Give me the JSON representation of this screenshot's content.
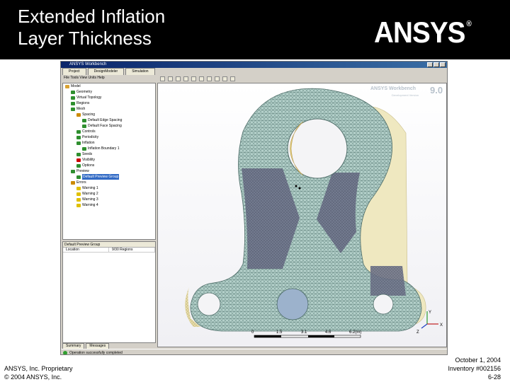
{
  "slide": {
    "title_line1": "Extended Inflation",
    "title_line2": "Layer Thickness",
    "logo_text": "ANSYS",
    "logo_mark": "®",
    "footer_left_line1": "ANSYS, Inc. Proprietary",
    "footer_left_line2": "© 2004 ANSYS, Inc.",
    "footer_right_line1": "October 1, 2004",
    "footer_right_line2": "Inventory #002156",
    "footer_right_line3": "6-28"
  },
  "window": {
    "title": "ANSYS Workbench",
    "tabs": [
      {
        "label": "Project"
      },
      {
        "label": "DesignModeler"
      },
      {
        "label": "Simulation"
      }
    ],
    "menu_label": "File  Tools  View  Units  Help",
    "tree": [
      {
        "label": "Model",
        "indent": 0,
        "icon": "model-icon",
        "color": "#d9a233"
      },
      {
        "label": "Geometry",
        "indent": 1,
        "icon": "geometry-icon",
        "color": "#2f8f2f"
      },
      {
        "label": "Virtual Topology",
        "indent": 1,
        "icon": "topology-icon",
        "color": "#2f8f2f"
      },
      {
        "label": "Regions",
        "indent": 1,
        "icon": "regions-icon",
        "color": "#2f8f2f"
      },
      {
        "label": "Mesh",
        "indent": 1,
        "icon": "mesh-icon",
        "color": "#2f8f2f"
      },
      {
        "label": "Spacing",
        "indent": 2,
        "icon": "spacing-icon",
        "color": "#cc8a00"
      },
      {
        "label": "Default Edge Spacing",
        "indent": 3,
        "icon": "edge-icon",
        "color": "#2f8f2f"
      },
      {
        "label": "Default Face Spacing",
        "indent": 3,
        "icon": "face-icon",
        "color": "#2f8f2f"
      },
      {
        "label": "Controls",
        "indent": 2,
        "icon": "controls-icon",
        "color": "#2f8f2f"
      },
      {
        "label": "Periodicity",
        "indent": 2,
        "icon": "periodicity-icon",
        "color": "#2f8f2f"
      },
      {
        "label": "Inflation",
        "indent": 2,
        "icon": "inflation-icon",
        "color": "#2f8f2f"
      },
      {
        "label": "Inflation Boundary 1",
        "indent": 3,
        "icon": "boundary-icon",
        "color": "#2f8f2f"
      },
      {
        "label": "Seeds",
        "indent": 2,
        "icon": "seeds-icon",
        "color": "#2f8f2f"
      },
      {
        "label": "Visibility",
        "indent": 2,
        "icon": "visibility-icon",
        "color": "#cc0000"
      },
      {
        "label": "Options",
        "indent": 2,
        "icon": "options-icon",
        "color": "#2f8f2f"
      },
      {
        "label": "Preview",
        "indent": 1,
        "icon": "preview-icon",
        "color": "#2f8f2f"
      },
      {
        "label": "Default Preview Group",
        "indent": 2,
        "icon": "preview-group-icon",
        "color": "#2f8f2f",
        "selected": true
      },
      {
        "label": "Errors",
        "indent": 1,
        "icon": "errors-icon",
        "color": "#cc8a00"
      },
      {
        "label": "Warning 1",
        "indent": 2,
        "icon": "warning-icon",
        "color": "#e0c000"
      },
      {
        "label": "Warning 2",
        "indent": 2,
        "icon": "warning-icon",
        "color": "#e0c000"
      },
      {
        "label": "Warning 3",
        "indent": 2,
        "icon": "warning-icon",
        "color": "#e0c000"
      },
      {
        "label": "Warning 4",
        "indent": 2,
        "icon": "warning-icon",
        "color": "#e0c000"
      }
    ],
    "details": {
      "header": "Default Preview Group",
      "rows": [
        {
          "key": "Location",
          "value": "9/30 Regions"
        }
      ]
    },
    "bottom_tabs": [
      {
        "label": "Summary"
      },
      {
        "label": "Messages"
      }
    ],
    "status": "Operation successfully completed",
    "viewport": {
      "brand": "ANSYS Workbench",
      "version": "9.0",
      "brand_sub": "Development Version",
      "scale_labels": [
        "0",
        "1.5",
        "3.1",
        "4.6",
        "6.2(m)"
      ],
      "axis_x": "X",
      "axis_y": "Y",
      "axis_z": "Z"
    }
  }
}
